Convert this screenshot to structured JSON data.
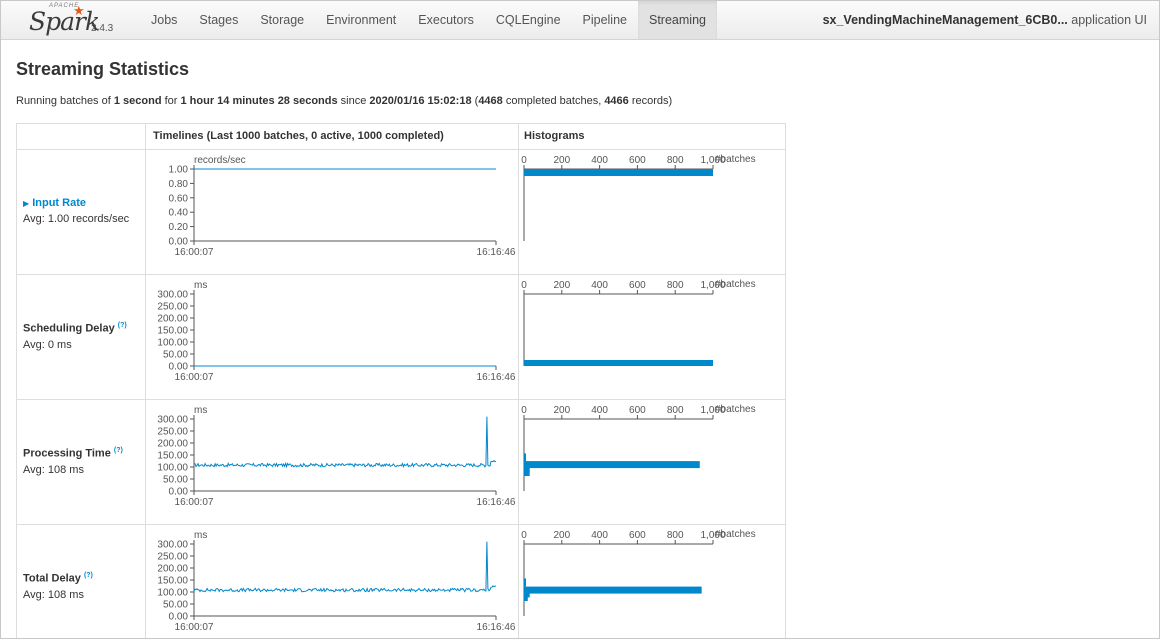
{
  "navbar": {
    "brand_apache": "APACHE",
    "brand_name": "Spark",
    "version": "2.4.3",
    "tabs": [
      "Jobs",
      "Stages",
      "Storage",
      "Environment",
      "Executors",
      "CQLEngine",
      "Pipeline",
      "Streaming"
    ],
    "active_tab": "Streaming",
    "app_name": "sx_VendingMachineManagement_6CB0...",
    "app_suffix": " application UI"
  },
  "page": {
    "title": "Streaming Statistics",
    "summary": {
      "p1": "Running batches of ",
      "interval": "1 second",
      "p2": " for ",
      "duration": "1 hour 14 minutes 28 seconds",
      "p3": " since ",
      "since": "2020/01/16 15:02:18",
      "p4": " (",
      "completed": "4468",
      "p5": " completed batches, ",
      "records": "4466",
      "p6": " records)"
    }
  },
  "table": {
    "header_timelines": "Timelines (Last 1000 batches, 0 active, 1000 completed)",
    "header_histograms": "Histograms",
    "hist_ticks": [
      "0",
      "200",
      "400",
      "600",
      "800",
      "1,000"
    ],
    "hist_unit": "#batches",
    "time_start": "16:00:07",
    "time_end": "16:16:46",
    "rows": [
      {
        "name": "Input Rate",
        "help": "",
        "avg": "Avg: 1.00 records/sec",
        "unit": "records/sec",
        "yticks": [
          "1.00",
          "0.80",
          "0.60",
          "0.40",
          "0.20",
          "0.00"
        ]
      },
      {
        "name": "Scheduling Delay",
        "help": "(?)",
        "avg": "Avg: 0 ms",
        "unit": "ms",
        "yticks": [
          "300.00",
          "250.00",
          "200.00",
          "150.00",
          "100.00",
          "50.00",
          "0.00"
        ]
      },
      {
        "name": "Processing Time",
        "help": "(?)",
        "avg": "Avg: 108 ms",
        "unit": "ms",
        "yticks": [
          "300.00",
          "250.00",
          "200.00",
          "150.00",
          "100.00",
          "50.00",
          "0.00"
        ]
      },
      {
        "name": "Total Delay",
        "help": "(?)",
        "avg": "Avg: 108 ms",
        "unit": "ms",
        "yticks": [
          "300.00",
          "250.00",
          "200.00",
          "150.00",
          "100.00",
          "50.00",
          "0.00"
        ]
      }
    ]
  },
  "chart_data": [
    {
      "type": "line",
      "title": "Input Rate",
      "ylabel": "records/sec",
      "ylim": [
        0,
        1.0
      ],
      "x_range": [
        "16:00:07",
        "16:16:46"
      ],
      "series": [
        {
          "values": [
            1.0,
            1.0
          ]
        }
      ]
    },
    {
      "type": "bar",
      "title": "Input Rate",
      "xlabel": "#batches",
      "xlim": [
        0,
        1000
      ],
      "bins": [
        {
          "value": 1.0,
          "count": 1000
        }
      ]
    },
    {
      "type": "line",
      "title": "Scheduling Delay",
      "ylabel": "ms",
      "ylim": [
        0,
        300
      ],
      "x_range": [
        "16:00:07",
        "16:16:46"
      ],
      "series": [
        {
          "values": [
            0,
            0
          ]
        }
      ]
    },
    {
      "type": "bar",
      "title": "Scheduling Delay",
      "xlabel": "#batches",
      "xlim": [
        0,
        1000
      ],
      "bins": [
        {
          "value": 0,
          "count": 1000
        }
      ]
    },
    {
      "type": "line",
      "title": "Processing Time",
      "ylabel": "ms",
      "ylim": [
        0,
        300
      ],
      "x_range": [
        "16:00:07",
        "16:16:46"
      ],
      "series": [
        {
          "values": [
            108,
            108
          ]
        }
      ],
      "spike": 310
    },
    {
      "type": "bar",
      "title": "Processing Time",
      "xlabel": "#batches",
      "xlim": [
        0,
        1000
      ],
      "bins": [
        {
          "value": 140,
          "count": 10
        },
        {
          "value": 110,
          "count": 930
        },
        {
          "value": 90,
          "count": 30
        },
        {
          "value": 75,
          "count": 30
        }
      ]
    },
    {
      "type": "line",
      "title": "Total Delay",
      "ylabel": "ms",
      "ylim": [
        0,
        300
      ],
      "x_range": [
        "16:00:07",
        "16:16:46"
      ],
      "series": [
        {
          "values": [
            108,
            108
          ]
        }
      ],
      "spike": 310
    },
    {
      "type": "bar",
      "title": "Total Delay",
      "xlabel": "#batches",
      "xlim": [
        0,
        1000
      ],
      "bins": [
        {
          "value": 140,
          "count": 10
        },
        {
          "value": 108,
          "count": 940
        },
        {
          "value": 90,
          "count": 30
        },
        {
          "value": 75,
          "count": 20
        }
      ]
    }
  ],
  "colors": {
    "accent": "#0088cc",
    "brand_orange": "#e25a1c"
  }
}
